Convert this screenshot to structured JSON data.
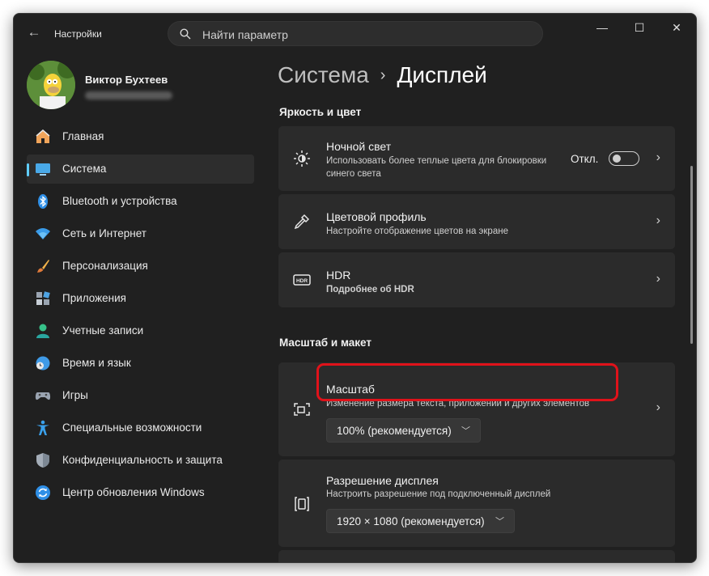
{
  "app": {
    "title": "Настройки"
  },
  "search": {
    "placeholder": "Найти параметр"
  },
  "user": {
    "name": "Виктор Бухтеев"
  },
  "nav": [
    {
      "label": "Главная",
      "icon": "home-icon"
    },
    {
      "label": "Система",
      "icon": "system-display-icon",
      "active": true
    },
    {
      "label": "Bluetooth и устройства",
      "icon": "bluetooth-icon"
    },
    {
      "label": "Сеть и Интернет",
      "icon": "wifi-icon"
    },
    {
      "label": "Персонализация",
      "icon": "brush-icon"
    },
    {
      "label": "Приложения",
      "icon": "apps-icon"
    },
    {
      "label": "Учетные записи",
      "icon": "accounts-icon"
    },
    {
      "label": "Время и язык",
      "icon": "time-language-icon"
    },
    {
      "label": "Игры",
      "icon": "gamepad-icon"
    },
    {
      "label": "Специальные возможности",
      "icon": "accessibility-icon"
    },
    {
      "label": "Конфиденциальность и защита",
      "icon": "shield-icon"
    },
    {
      "label": "Центр обновления Windows",
      "icon": "update-icon"
    }
  ],
  "breadcrumb": {
    "parent": "Система",
    "separator": "›",
    "current": "Дисплей"
  },
  "sections": {
    "brightness": "Яркость и цвет",
    "scale_layout": "Масштаб и макет"
  },
  "cards": {
    "night_light": {
      "title": "Ночной свет",
      "desc_line1": "Использовать более теплые цвета для блокировки",
      "desc_line2": "синего света",
      "state": "Откл."
    },
    "color_profile": {
      "title": "Цветовой профиль",
      "desc": "Настройте отображение цветов на экране"
    },
    "hdr": {
      "title": "HDR",
      "link": "Подробнее об HDR"
    },
    "scale": {
      "title": "Масштаб",
      "desc": "Изменение размера текста, приложений и других элементов",
      "value": "100% (рекомендуется)"
    },
    "resolution": {
      "title": "Разрешение дисплея",
      "desc": "Настроить разрешение под подключенный дисплей",
      "value": "1920 × 1080 (рекомендуется)"
    }
  },
  "colors": {
    "accent": "#60cdff",
    "highlight": "#e0121a",
    "bg": "#202020",
    "card": "#2b2b2b"
  }
}
